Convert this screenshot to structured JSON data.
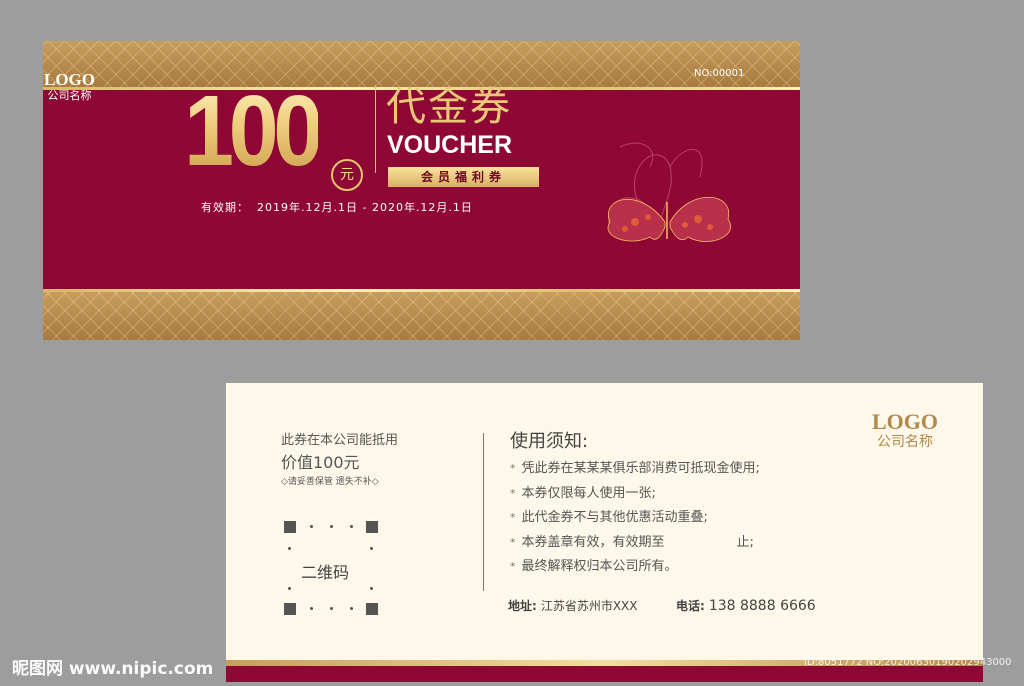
{
  "front": {
    "logo": "LOGO",
    "company": "公司名称",
    "serial": "NO:00001",
    "amount": "100",
    "unit": "元",
    "title_cn": "代金券",
    "title_en": "VOUCHER",
    "badge": "会员福利券",
    "validity_label": "有效期：",
    "validity_value": "2019年.12月.1日 - 2020年.12月.1日"
  },
  "back": {
    "offset_text": "此券在本公司能抵用",
    "value_text": "价值100元",
    "keep_note": "◇请妥善保管 遗失不补◇",
    "qr_label": "二维码",
    "notice_title": "使用须知:",
    "notice_items": [
      "凭此券在某某某俱乐部消费可抵现金使用;",
      "本券仅限每人使用一张;",
      "此代金券不与其他优惠活动重叠;",
      "本券盖章有效，有效期至",
      "最终解释权归本公司所有。"
    ],
    "notice_item_4_tail": "止;",
    "address_label": "地址:",
    "address_value": "江苏省苏州市XXX",
    "phone_label": "电话:",
    "phone_value": "138 8888 6666",
    "logo": "LOGO",
    "company": "公司名称"
  },
  "watermark": {
    "left": "昵图网 www.nipic.com",
    "right": "ID:8051772 NO:20200630190202943000"
  },
  "colors": {
    "burgundy": "#8f0835",
    "gold": "#c79d5c",
    "cream": "#fdf8e9"
  }
}
